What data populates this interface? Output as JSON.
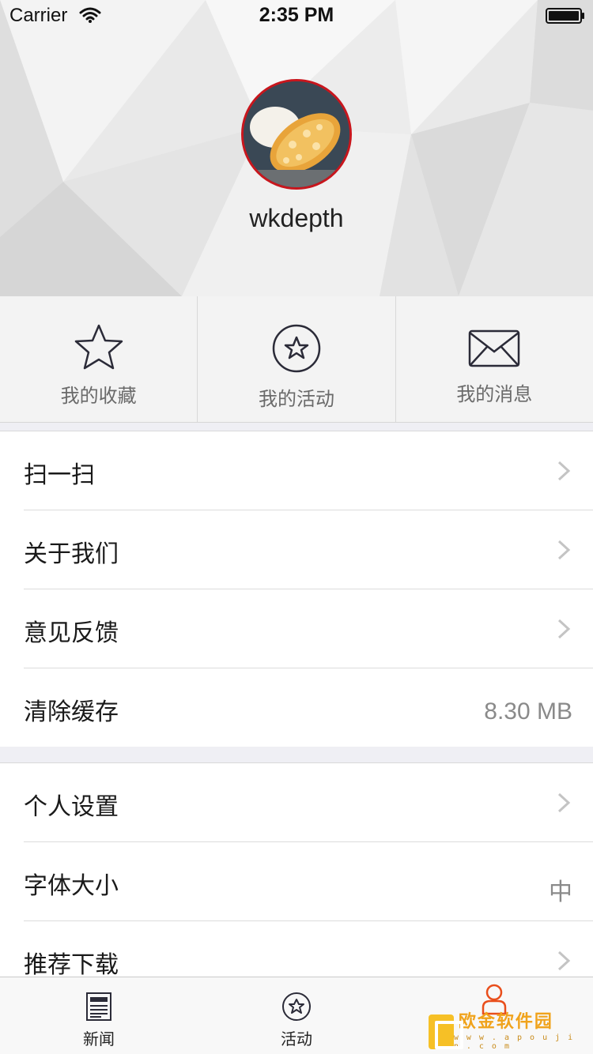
{
  "status": {
    "carrier": "Carrier",
    "time": "2:35 PM"
  },
  "profile": {
    "username": "wkdepth"
  },
  "quick_actions": [
    {
      "label": "我的收藏",
      "icon": "star-outline-icon"
    },
    {
      "label": "我的活动",
      "icon": "star-circle-icon"
    },
    {
      "label": "我的消息",
      "icon": "envelope-icon"
    }
  ],
  "settings_group1": [
    {
      "label": "扫一扫",
      "chevron": true
    },
    {
      "label": "关于我们",
      "chevron": true
    },
    {
      "label": "意见反馈",
      "chevron": true
    },
    {
      "label": "清除缓存",
      "value": "8.30 MB"
    }
  ],
  "settings_group2": [
    {
      "label": "个人设置",
      "chevron": true
    },
    {
      "label": "字体大小",
      "value": "中"
    },
    {
      "label": "推荐下载",
      "chevron": true
    }
  ],
  "tabs": [
    {
      "label": "新闻",
      "icon": "newspaper-icon"
    },
    {
      "label": "活动",
      "icon": "star-circle-icon"
    },
    {
      "label": "",
      "icon": "person-icon",
      "active": true
    }
  ],
  "watermark": {
    "text": "欧金软件园",
    "url": "w w w . a p o u j i n . c o m"
  },
  "colors": {
    "accent": "#e94e1b",
    "avatar_ring": "#c8161d"
  }
}
